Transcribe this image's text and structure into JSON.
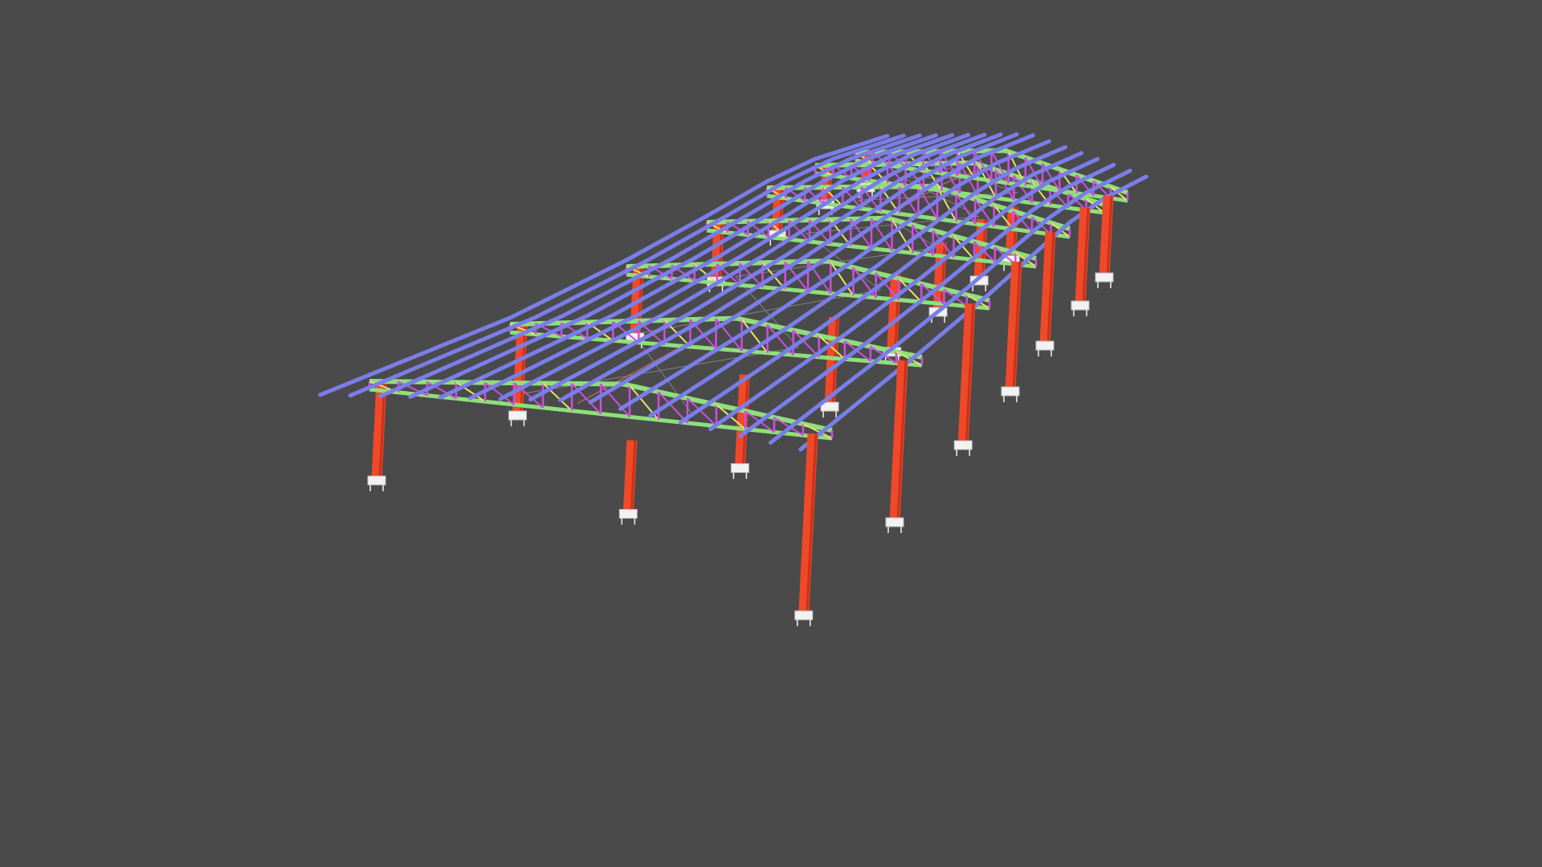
{
  "viewer": {
    "background": "#4a4a4a",
    "model": {
      "bays": 6,
      "frames": 7,
      "purlins_per_side": 8,
      "colors": {
        "column": "#f0492a",
        "column_edge": "#c8321a",
        "base_plate": "#f2f2f2",
        "truss_chord": "#8ee07a",
        "truss_web": "#d24ce6",
        "purlin": "#7a7ee8",
        "bracing": "#c86b6b",
        "sag_rod": "#9a9a9a",
        "yellow_web": "#e8e26a"
      }
    }
  }
}
